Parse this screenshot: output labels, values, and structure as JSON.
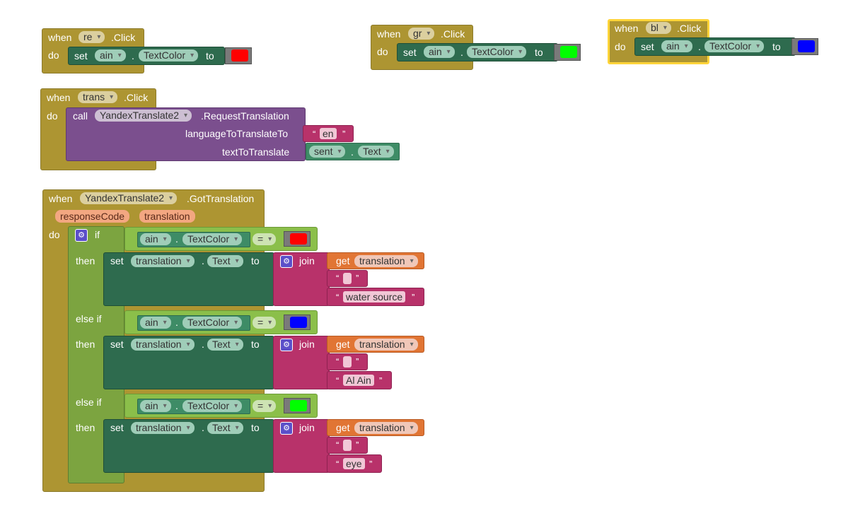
{
  "kw": {
    "when": "when",
    "do": "do",
    "set": "set",
    "to": "to",
    "call": "call",
    "dot": ".",
    "if": "if",
    "then": "then",
    "else_if": "else if",
    "join": "join",
    "get": "get",
    "click": ".Click",
    "eq": "=",
    "q_open": "“",
    "q_close": "”"
  },
  "events": [
    {
      "component": "re",
      "target": "ain",
      "property": "TextColor",
      "color": "#ff0000"
    },
    {
      "component": "gr",
      "target": "ain",
      "property": "TextColor",
      "color": "#00ff00"
    },
    {
      "component": "bl",
      "target": "ain",
      "property": "TextColor",
      "color": "#0000ff"
    }
  ],
  "trans_block": {
    "component": "trans",
    "call_component": "YandexTranslate2",
    "method": ".RequestTranslation",
    "arg1_label": "languageToTranslateTo",
    "arg1_value": "en",
    "arg2_label": "textToTranslate",
    "arg2_component": "sent",
    "arg2_property": "Text"
  },
  "got_block": {
    "component": "YandexTranslate2",
    "event": ".GotTranslation",
    "param1": "responseCode",
    "param2": "translation",
    "branches": [
      {
        "cond_comp": "ain",
        "cond_prop": "TextColor",
        "cond_color": "#ff0000",
        "set_comp": "translation",
        "set_prop": "Text",
        "get_var": "translation",
        "suffix": "water source"
      },
      {
        "cond_comp": "ain",
        "cond_prop": "TextColor",
        "cond_color": "#0000ff",
        "set_comp": "translation",
        "set_prop": "Text",
        "get_var": "translation",
        "suffix": "Al Ain"
      },
      {
        "cond_comp": "ain",
        "cond_prop": "TextColor",
        "cond_color": "#00ff00",
        "set_comp": "translation",
        "set_prop": "Text",
        "get_var": "translation",
        "suffix": "eye"
      }
    ]
  },
  "colors": {
    "event": "#ad9532",
    "setter": "#2e6b4e",
    "procedure": "#7b4f8e",
    "text": "#b8326a",
    "get": "#e17534",
    "control": "#7ca440",
    "selected_outline": "#ffd43a"
  }
}
